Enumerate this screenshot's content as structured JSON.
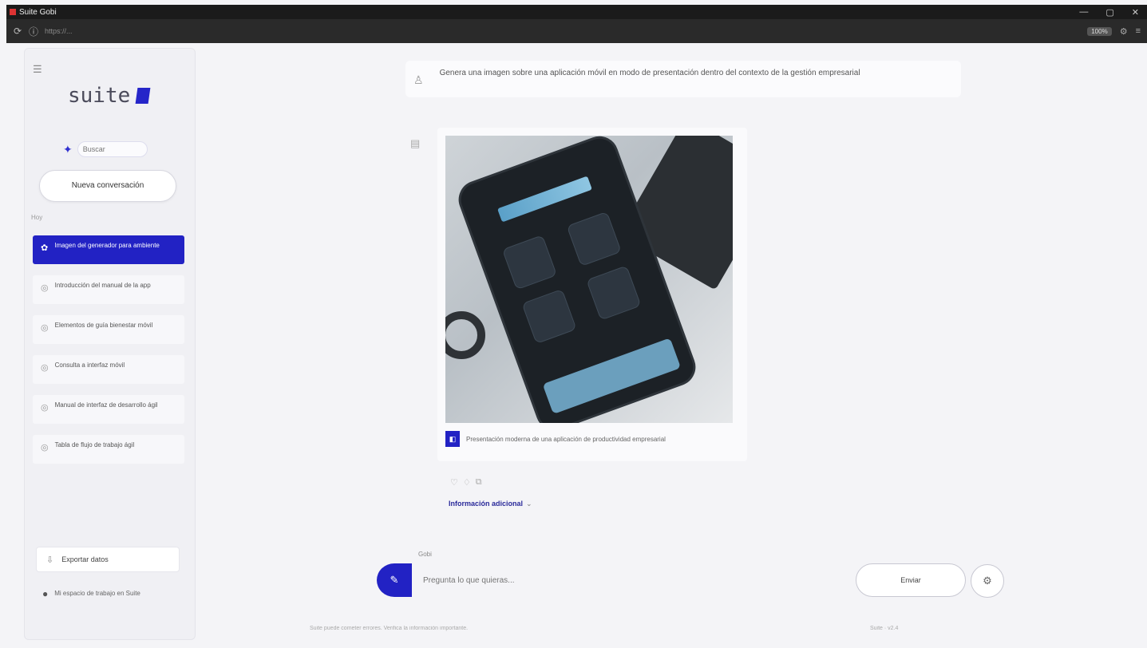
{
  "browser": {
    "tab_title": "Suite Gobi",
    "url": "https://...",
    "zoom": "100%",
    "win_min": "—",
    "win_max": "▢",
    "win_close": "✕"
  },
  "sidebar": {
    "logo_text": "suite",
    "search_placeholder": "Buscar",
    "new_conversation_label": "Nueva conversación",
    "section_label": "Hoy",
    "items": [
      {
        "label": "Imagen del generador para ambiente",
        "active": true
      },
      {
        "label": "Introducción del manual de la app",
        "active": false
      },
      {
        "label": "Elementos de guía bienestar móvil",
        "active": false
      },
      {
        "label": "Consulta a interfaz móvil",
        "active": false
      },
      {
        "label": "Manual de interfaz de desarrollo ágil",
        "active": false
      },
      {
        "label": "Tabla de flujo de trabajo ágil",
        "active": false
      }
    ],
    "export_label": "Exportar datos",
    "footer_note": "Mi espacio de trabajo en Suite"
  },
  "chat": {
    "user_message": "Genera una imagen sobre una aplicación móvil en modo de presentación dentro del contexto de la gestión empresarial",
    "image_caption": "Presentación moderna de una aplicación de productividad empresarial",
    "more_link": "Información adicional",
    "model_label": "Gobi"
  },
  "composer": {
    "placeholder": "Pregunta lo que quieras...",
    "send_label": "Enviar",
    "disclaimer": "Suite puede cometer errores. Verifica la información importante.",
    "version": "Suite · v2.4"
  },
  "colors": {
    "accent": "#2222c4",
    "background": "#f4f4f7"
  }
}
